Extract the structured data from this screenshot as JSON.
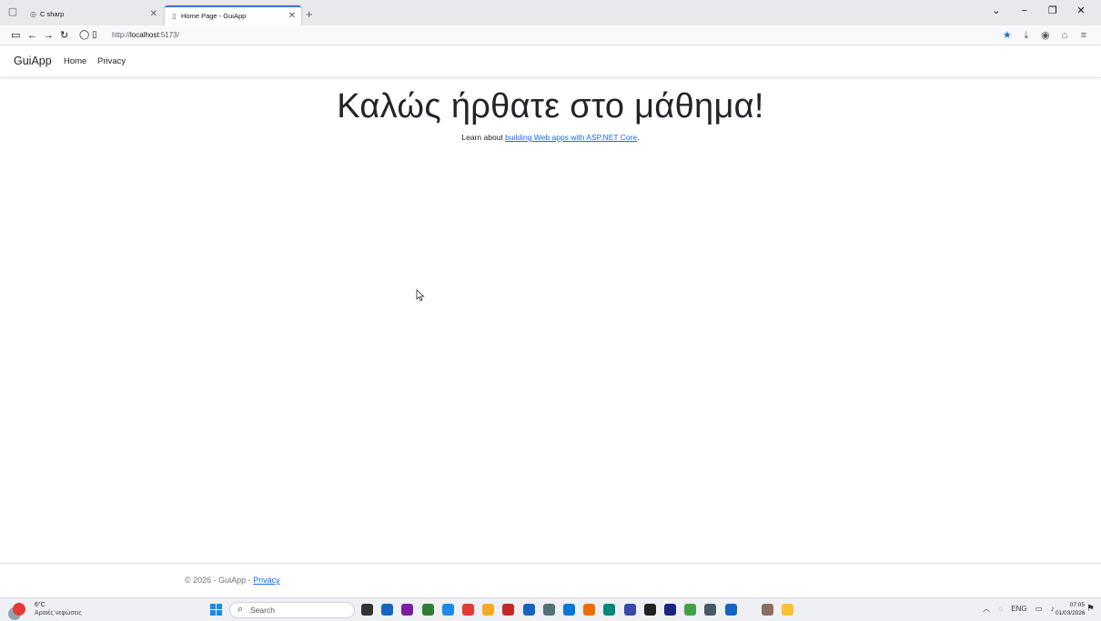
{
  "browser": {
    "tabs": [
      {
        "label": "C sharp"
      },
      {
        "label": "Home Page - GuiApp"
      }
    ],
    "url": {
      "scheme": "http://",
      "host": "localhost",
      "rest": ":5173/"
    }
  },
  "site": {
    "brand": "GuiApp",
    "nav": [
      {
        "label": "Home"
      },
      {
        "label": "Privacy"
      }
    ],
    "title": "Καλώς ήρθατε στο μάθημα!",
    "lead": {
      "prefix": "Learn about ",
      "link": "building Web apps with ASP.NET Core",
      "suffix": "."
    },
    "footer": {
      "text": "© 2026 - GuiApp - ",
      "link": "Privacy"
    }
  },
  "taskbar": {
    "weather": {
      "temp": "6°C",
      "desc": "Αραιές νεφώσεις"
    },
    "search_label": "Search",
    "tray_lang": "ENG",
    "time": "07:05",
    "date": "01/03/2026",
    "app_colors": [
      "#333333",
      "#1565c0",
      "#7b1fa2",
      "#2e7d32",
      "#1e88e5",
      "#e53935",
      "#f9a825",
      "#c62828",
      "#1565c0",
      "#546e7a",
      "#0078d4",
      "#ef6c00",
      "#00897b",
      "#3949ab",
      "#212121",
      "#1a237e",
      "#43a047",
      "#455a64",
      "#1565c0",
      "#8d6e63",
      "#fbc02d"
    ]
  }
}
